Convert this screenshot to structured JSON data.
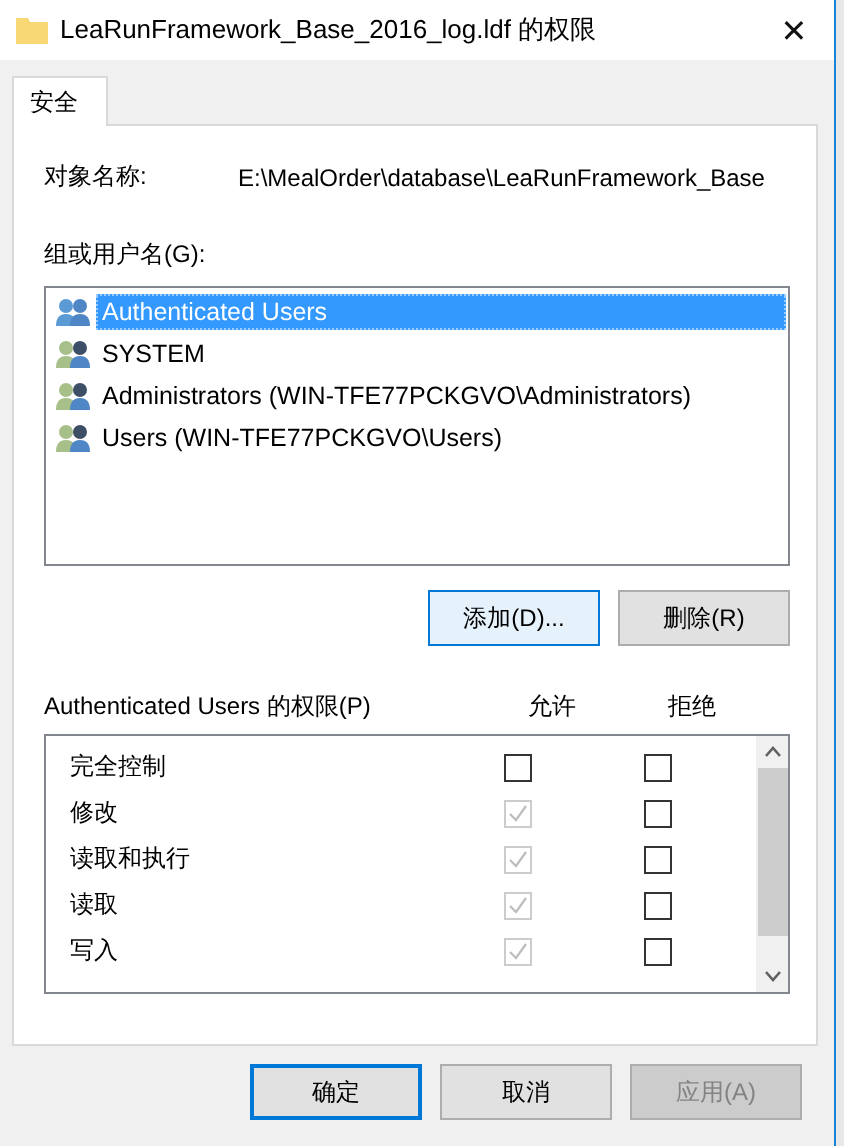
{
  "window": {
    "title": "LeaRunFramework_Base_2016_log.ldf 的权限",
    "close": "✕"
  },
  "tabs": [
    {
      "label": "安全",
      "selected": true
    }
  ],
  "object_name": {
    "label": "对象名称:",
    "value": "E:\\MealOrder\\database\\LeaRunFramework_Base"
  },
  "users": {
    "label": "组或用户名(G):",
    "items": [
      {
        "name": "Authenticated Users",
        "selected": true
      },
      {
        "name": "SYSTEM",
        "selected": false
      },
      {
        "name": "Administrators (WIN-TFE77PCKGVO\\Administrators)",
        "selected": false
      },
      {
        "name": "Users (WIN-TFE77PCKGVO\\Users)",
        "selected": false
      }
    ]
  },
  "user_buttons": [
    {
      "label": "添加(D)...",
      "focused": true,
      "disabled": false
    },
    {
      "label": "删除(R)",
      "focused": false,
      "disabled": false
    }
  ],
  "permissions": {
    "label": "Authenticated Users 的权限(P)",
    "allow_header": "允许",
    "deny_header": "拒绝",
    "rows": [
      {
        "name": "完全控制",
        "allow": {
          "checked": false,
          "disabled": false
        },
        "deny": {
          "checked": false,
          "disabled": false
        }
      },
      {
        "name": "修改",
        "allow": {
          "checked": true,
          "disabled": true
        },
        "deny": {
          "checked": false,
          "disabled": false
        }
      },
      {
        "name": "读取和执行",
        "allow": {
          "checked": true,
          "disabled": true
        },
        "deny": {
          "checked": false,
          "disabled": false
        }
      },
      {
        "name": "读取",
        "allow": {
          "checked": true,
          "disabled": true
        },
        "deny": {
          "checked": false,
          "disabled": false
        }
      },
      {
        "name": "写入",
        "allow": {
          "checked": true,
          "disabled": true
        },
        "deny": {
          "checked": false,
          "disabled": false
        }
      }
    ]
  },
  "buttons": [
    {
      "label": "确定",
      "default": true,
      "disabled": false
    },
    {
      "label": "取消",
      "default": false,
      "disabled": false
    },
    {
      "label": "应用(A)",
      "default": false,
      "disabled": true
    }
  ]
}
